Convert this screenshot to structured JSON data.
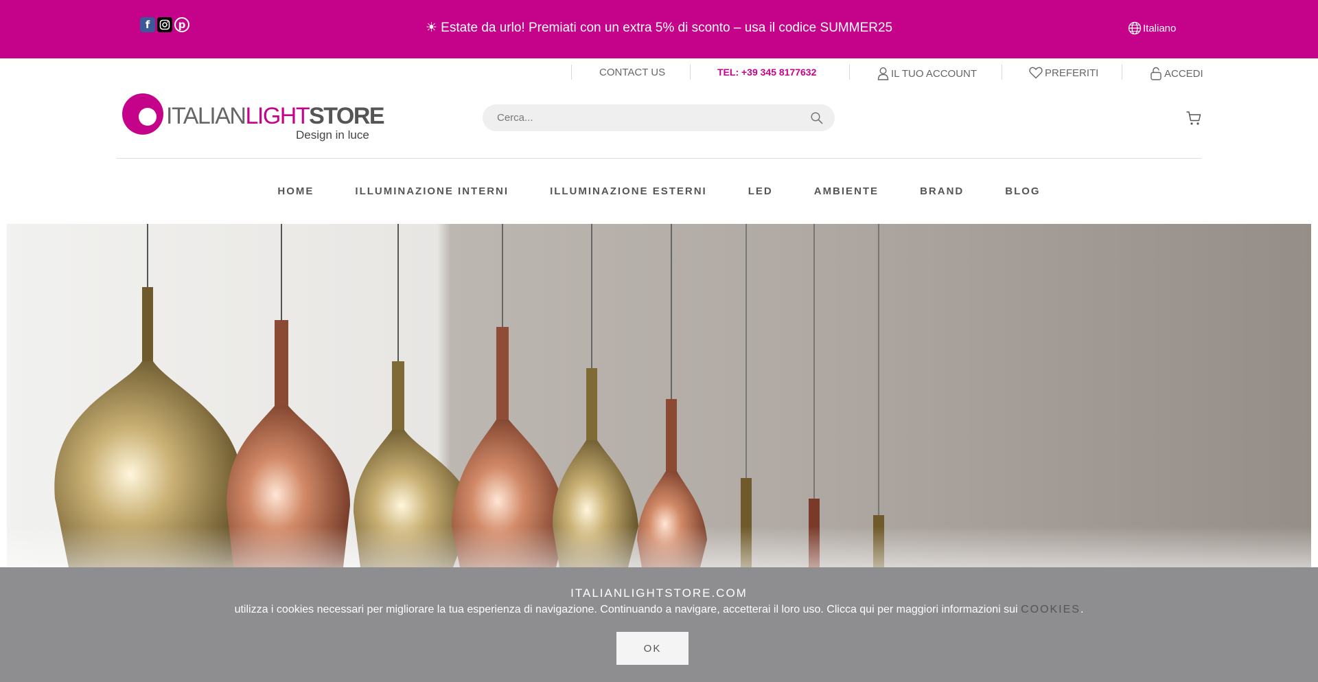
{
  "promo": {
    "message": "☀ Estate da urlo! Premiati con un extra 5% di sconto – usa il codice SUMMER25",
    "language": "Italiano",
    "background_color": "#c4038a",
    "social_icons": [
      "facebook-icon",
      "instagram-icon",
      "pinterest-icon"
    ]
  },
  "utility": {
    "contact": "CONTACT US",
    "phone": "TEL: +39 345 8177632",
    "account": "IL TUO ACCOUNT",
    "favorites": "PREFERITI",
    "login": "ACCEDI"
  },
  "header": {
    "logo": {
      "italian": "ITALIAN",
      "light": "LIGHT",
      "store": "STORE",
      "tagline": "Design in luce"
    },
    "search_placeholder": "Cerca...",
    "accent_color": "#c4038a"
  },
  "nav": {
    "items": [
      {
        "label": "HOME"
      },
      {
        "label": "ILLUMINAZIONE INTERNI"
      },
      {
        "label": "ILLUMINAZIONE ESTERNI"
      },
      {
        "label": "LED"
      },
      {
        "label": "AMBIENTE"
      },
      {
        "label": "BRAND"
      },
      {
        "label": "BLOG"
      }
    ]
  },
  "cookie": {
    "title": "ITALIANLIGHTSTORE.COM",
    "text": "utilizza i cookies necessari per migliorare la tua esperienza di navigazione. Continuando a navigare, accetterai il loro uso. Clicca qui per maggiori informazioni sui ",
    "link": "COOKIES",
    "suffix": ".",
    "ok": "OK"
  }
}
